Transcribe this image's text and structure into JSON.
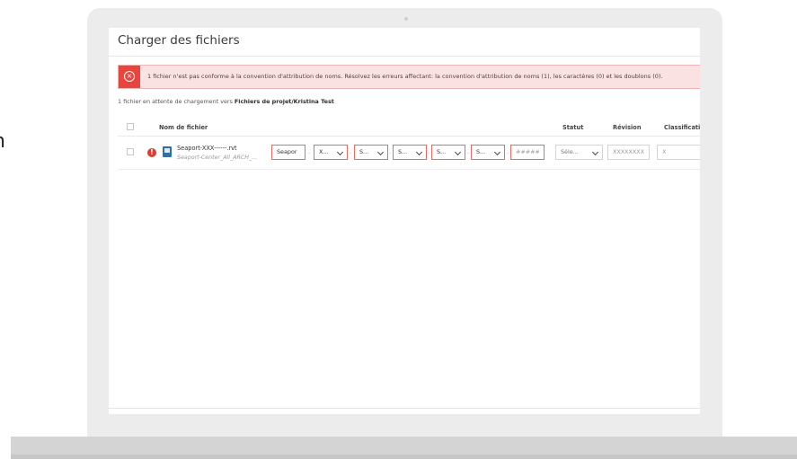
{
  "dialog": {
    "title": "Charger des fichiers"
  },
  "error_banner": {
    "message": "1 fichier n'est pas conforme à la convention d'attribution de noms. Résolvez les erreurs affectant: la convention d'attribution de noms (1), les caractères (0) et les doublons (0)."
  },
  "pending": {
    "prefix": "1 fichier en attente de chargement vers ",
    "destination": "Fichiers de projet/Kristina Test"
  },
  "table": {
    "columns": {
      "name": "Nom de fichier",
      "status": "Statut",
      "revision": "Révision",
      "classification": "Classification"
    },
    "rows": [
      {
        "file_name": "Seaport-XXX------.rvt",
        "file_sub": "Seaport-Center_All_ARCH_...",
        "fields": {
          "project": "Seapor",
          "f2": "X...",
          "f3": "S...",
          "f4": "S...",
          "f5": "S...",
          "f6": "S...",
          "number": "#####",
          "status": "Séle...",
          "revision": "XXXXXXXX",
          "classification": "X"
        }
      }
    ]
  },
  "colors": {
    "error_red": "#e9453f",
    "error_bg": "#fbe2e2",
    "field_error_border": "#ea6b64"
  }
}
